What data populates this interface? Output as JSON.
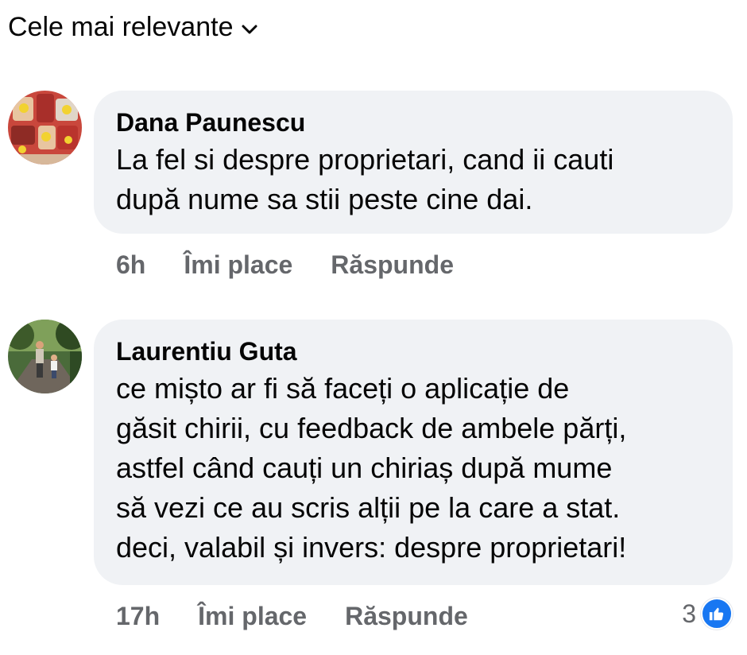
{
  "sort": {
    "label": "Cele mai relevante",
    "icon": "chevron-down-icon"
  },
  "comments": [
    {
      "author": "Dana Paunescu",
      "text": "La fel si despre proprietari, cand ii cauti\ndupă nume sa stii peste cine dai.",
      "time": "6h",
      "like_label": "Îmi place",
      "reply_label": "Răspunde",
      "avatar_icon": "cartoon-avatar-icon"
    },
    {
      "author": "Laurentiu Guta",
      "text": "ce mișto ar fi să faceți o aplicație de\ngăsit chirii, cu feedback de ambele părți,\nastfel când cauți un chiriaș după mume\nsă vezi ce au scris alții pe la care a stat.\ndeci, valabil și invers: despre proprietari!",
      "time": "17h",
      "like_label": "Îmi place",
      "reply_label": "Răspunde",
      "reaction_count": "3",
      "reaction_icon": "thumbs-up-icon",
      "avatar_icon": "photo-avatar-icon"
    }
  ],
  "colors": {
    "bubble": "#f0f2f5",
    "meta": "#65676b",
    "like_blue": "#1877f2"
  }
}
